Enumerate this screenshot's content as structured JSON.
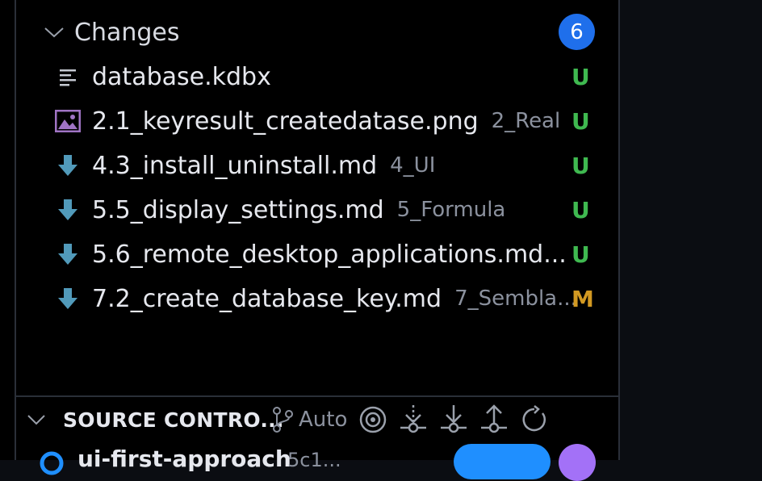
{
  "changes": {
    "title": "Changes",
    "count": "6",
    "files": [
      {
        "name": "database.kdbx",
        "dir": "",
        "status": "U",
        "icon": "text-file-icon"
      },
      {
        "name": "2.1_keyresult_createdatase.png",
        "dir": "2_Real",
        "status": "U",
        "icon": "image-file-icon"
      },
      {
        "name": "4.3_install_uninstall.md",
        "dir": "4_UI",
        "status": "U",
        "icon": "markdown-file-icon"
      },
      {
        "name": "5.5_display_settings.md",
        "dir": "5_Formula",
        "status": "U",
        "icon": "markdown-file-icon"
      },
      {
        "name": "5.6_remote_desktop_applications.md...",
        "dir": "",
        "status": "U",
        "icon": "markdown-file-icon"
      },
      {
        "name": "7.2_create_database_key.md",
        "dir": "7_Sembla...",
        "status": "M",
        "icon": "markdown-file-icon"
      }
    ]
  },
  "source_control": {
    "title": "SOURCE CONTRO...",
    "auto_label": "Auto"
  },
  "branch": {
    "name": "ui-first-approach",
    "sub": "5c1..."
  },
  "colors": {
    "badge": "#1f6feb",
    "untracked": "#3fb950",
    "modified": "#d29922"
  }
}
